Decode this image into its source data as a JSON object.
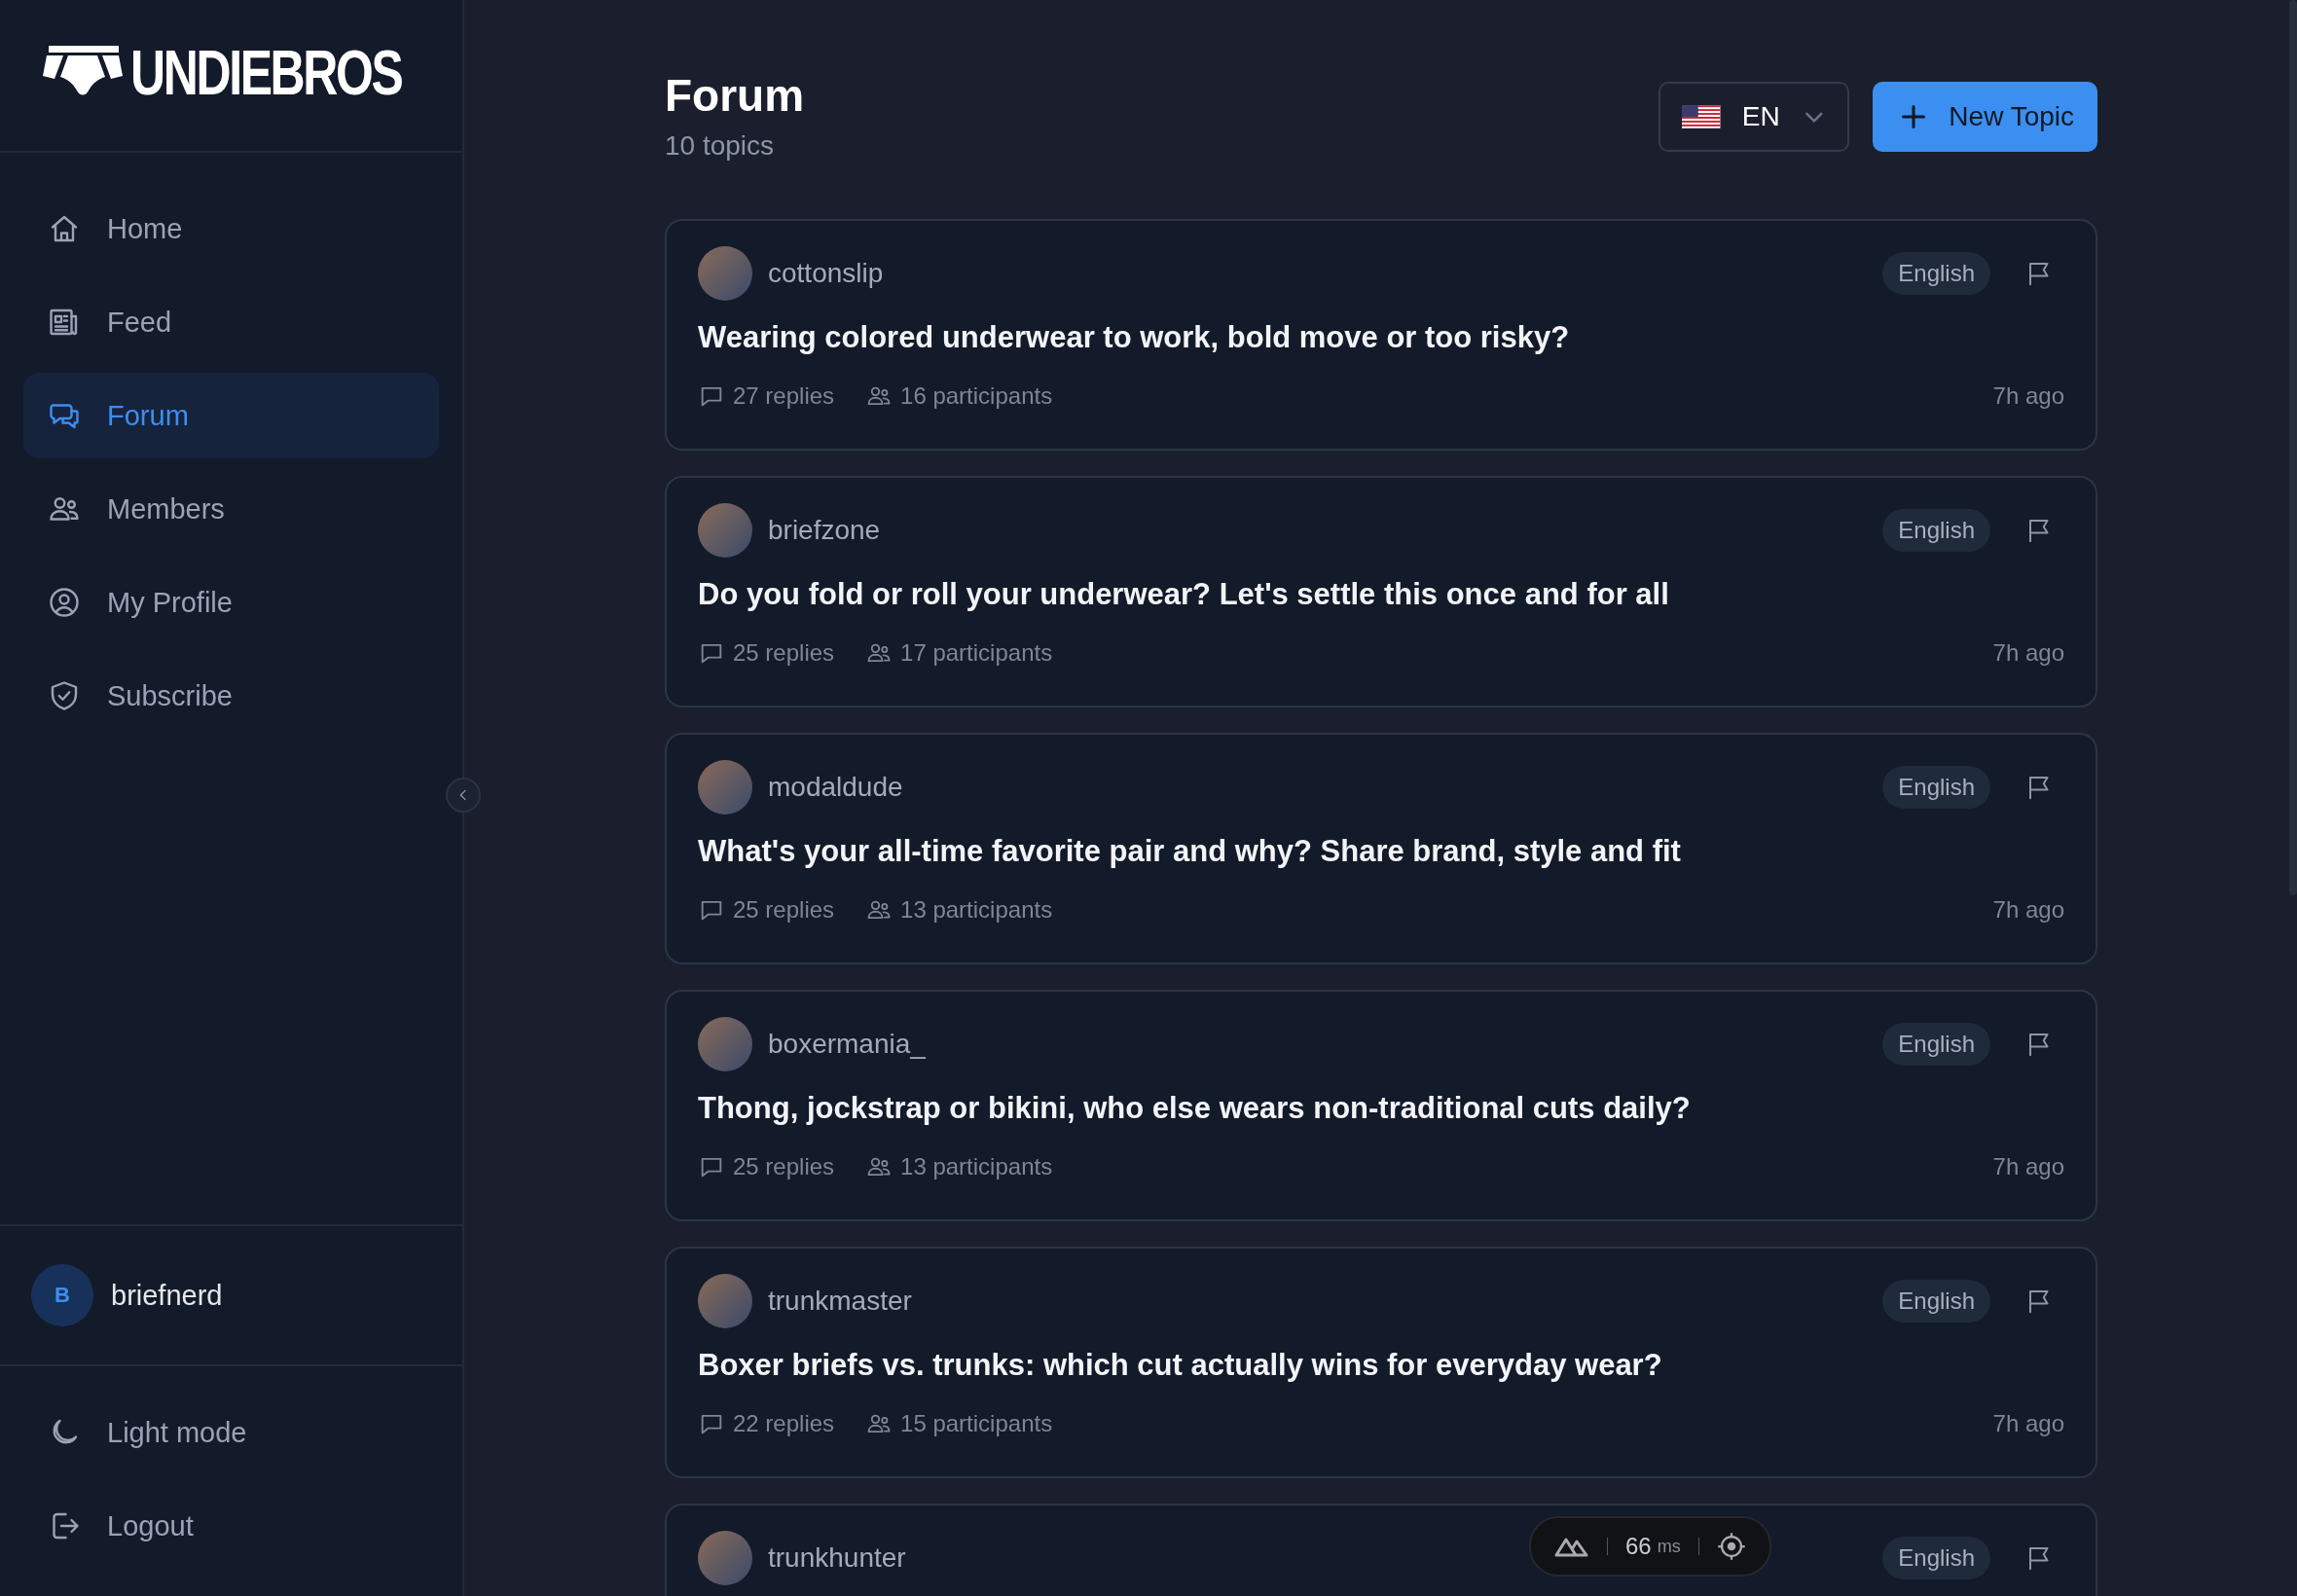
{
  "sidebar": {
    "logo": "UNDIEBROS",
    "nav": [
      {
        "label": "Home",
        "selected": false
      },
      {
        "label": "Feed",
        "selected": false
      },
      {
        "label": "Forum",
        "selected": true
      },
      {
        "label": "Members",
        "selected": false
      },
      {
        "label": "My Profile",
        "selected": false
      },
      {
        "label": "Subscribe",
        "selected": false
      }
    ],
    "user": {
      "initial": "B",
      "name": "briefnerd"
    },
    "footer": [
      {
        "label": "Light mode"
      },
      {
        "label": "Logout"
      }
    ]
  },
  "header": {
    "title": "Forum",
    "subtitle": "10 topics",
    "language": "EN",
    "new_button": "New Topic"
  },
  "topics": [
    {
      "author": "cottonslip",
      "language": "English",
      "title": "Wearing colored underwear to work, bold move or too risky?",
      "replies": "27 replies",
      "participants": "16 participants",
      "time": "7h ago"
    },
    {
      "author": "briefzone",
      "language": "English",
      "title": "Do you fold or roll your underwear? Let's settle this once and for all",
      "replies": "25 replies",
      "participants": "17 participants",
      "time": "7h ago"
    },
    {
      "author": "modaldude",
      "language": "English",
      "title": "What's your all-time favorite pair and why? Share brand, style and fit",
      "replies": "25 replies",
      "participants": "13 participants",
      "time": "7h ago"
    },
    {
      "author": "boxermania_",
      "language": "English",
      "title": "Thong, jockstrap or bikini, who else wears non-traditional cuts daily?",
      "replies": "25 replies",
      "participants": "13 participants",
      "time": "7h ago"
    },
    {
      "author": "trunkmaster",
      "language": "English",
      "title": "Boxer briefs vs. trunks: which cut actually wins for everyday wear?",
      "replies": "22 replies",
      "participants": "15 participants",
      "time": "7h ago"
    },
    {
      "author": "trunkhunter",
      "language": "English"
    }
  ],
  "devtools": {
    "value": "66",
    "unit": "ms"
  }
}
